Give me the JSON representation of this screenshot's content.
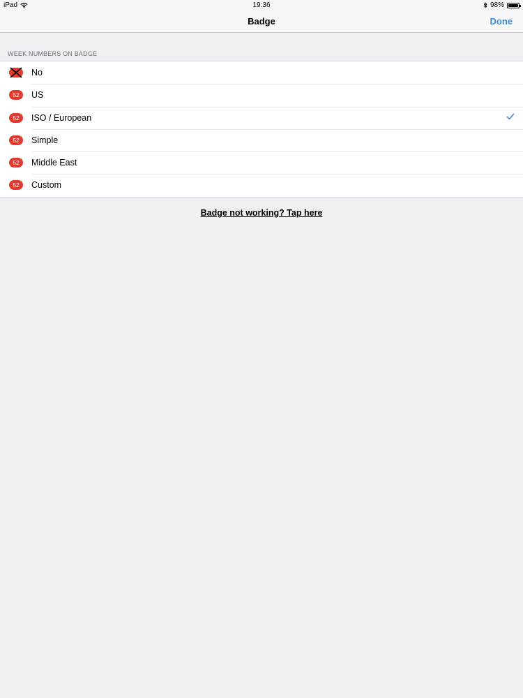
{
  "status_bar": {
    "device": "iPad",
    "time": "19:36",
    "battery": "98%",
    "battery_level": 0.98,
    "icons": [
      "wifi-icon",
      "bluetooth-icon",
      "battery-icon"
    ]
  },
  "nav": {
    "title": "Badge",
    "done_label": "Done",
    "accent_color": "#3b8ad8"
  },
  "section": {
    "header": "WEEK NUMBERS ON BADGE",
    "options": [
      {
        "label": "No",
        "badge": "",
        "badge_icon": "badge-off-icon",
        "selected": false
      },
      {
        "label": "US",
        "badge": "52",
        "selected": false
      },
      {
        "label": "ISO / European",
        "badge": "52",
        "selected": true
      },
      {
        "label": "Simple",
        "badge": "52",
        "selected": false
      },
      {
        "label": "Middle East",
        "badge": "52",
        "selected": false
      },
      {
        "label": "Custom",
        "badge": "52",
        "selected": false
      }
    ],
    "badge_color": "#e4392f"
  },
  "help_link": "Badge not working? Tap here"
}
